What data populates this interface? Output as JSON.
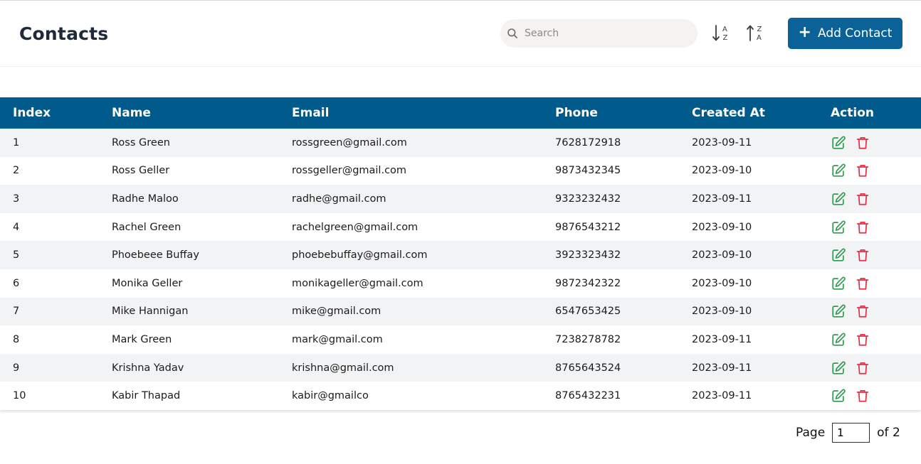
{
  "header": {
    "title": "Contacts",
    "search_placeholder": "Search",
    "add_label": "Add Contact",
    "sort_asc_icon": "sort-alpha-down-icon",
    "sort_desc_icon": "sort-alpha-up-icon"
  },
  "colors": {
    "header_bg": "#005a8b",
    "primary": "#0b6298",
    "edit": "#2e9a4e",
    "delete": "#e0314b",
    "row_alt": "#f2f3f5"
  },
  "table": {
    "columns": [
      "Index",
      "Name",
      "Email",
      "Phone",
      "Created At",
      "Action"
    ],
    "rows": [
      {
        "index": "1",
        "name": "Ross Green",
        "email": "rossgreen@gmail.com",
        "phone": "7628172918",
        "created": "2023-09-11"
      },
      {
        "index": "2",
        "name": "Ross Geller",
        "email": "rossgeller@gmail.com",
        "phone": "9873432345",
        "created": "2023-09-10"
      },
      {
        "index": "3",
        "name": "Radhe Maloo",
        "email": "radhe@gmail.com",
        "phone": "9323232432",
        "created": "2023-09-11"
      },
      {
        "index": "4",
        "name": "Rachel Green",
        "email": "rachelgreen@gmail.com",
        "phone": "9876543212",
        "created": "2023-09-10"
      },
      {
        "index": "5",
        "name": "Phoebeee Buffay",
        "email": "phoebebuffay@gmail.com",
        "phone": "3923323432",
        "created": "2023-09-10"
      },
      {
        "index": "6",
        "name": "Monika Geller",
        "email": "monikageller@gmail.com",
        "phone": "9872342322",
        "created": "2023-09-10"
      },
      {
        "index": "7",
        "name": "Mike Hannigan",
        "email": "mike@gmail.com",
        "phone": "6547653425",
        "created": "2023-09-10"
      },
      {
        "index": "8",
        "name": "Mark Green",
        "email": "mark@gmail.com",
        "phone": "7238278782",
        "created": "2023-09-11"
      },
      {
        "index": "9",
        "name": "Krishna Yadav",
        "email": "krishna@gmail.com",
        "phone": "8765643524",
        "created": "2023-09-11"
      },
      {
        "index": "10",
        "name": "Kabir Thapad",
        "email": "kabir@gmailco",
        "phone": "8765432231",
        "created": "2023-09-11"
      }
    ]
  },
  "pagination": {
    "label": "Page",
    "current": "1",
    "total_label": "of 2"
  }
}
